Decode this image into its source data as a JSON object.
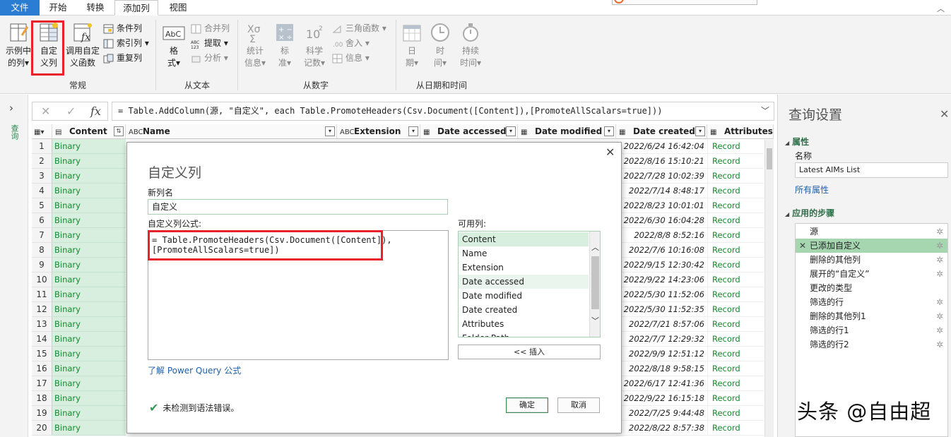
{
  "tabs": {
    "file": "文件",
    "home": "开始",
    "transform": "转换",
    "add_column": "添加列",
    "view": "视图"
  },
  "ribbon": {
    "general": {
      "label": "常规",
      "example_col": [
        "示例中",
        "的列"
      ],
      "custom_col": [
        "自定",
        "义列"
      ],
      "invoke_fn": [
        "调用自定",
        "义函数"
      ],
      "conditional": "条件列",
      "index": "索引列",
      "duplicate": "重复列"
    },
    "text": {
      "label": "从文本",
      "format": [
        "格",
        "式"
      ],
      "merge": "合并列",
      "extract": "提取",
      "parse": "分析"
    },
    "number": {
      "label": "从数字",
      "stats": [
        "统计",
        "信息"
      ],
      "standard": [
        "标",
        "准"
      ],
      "scientific": [
        "科学",
        "记数"
      ],
      "trig": "三角函数",
      "rounding": "舍入",
      "info": "信息"
    },
    "datetime": {
      "label": "从日期和时间",
      "date": [
        "日",
        "期"
      ],
      "time": [
        "时",
        "间"
      ],
      "duration": [
        "持续",
        "时间"
      ]
    }
  },
  "left_pane": {
    "label": "查询"
  },
  "formula_bar": {
    "text": "= Table.AddColumn(源, \"自定义\", each Table.PromoteHeaders(Csv.Document([Content]),[PromoteAllScalars=true]))"
  },
  "grid": {
    "columns": [
      "Content",
      "Name",
      "Extension",
      "Date accessed",
      "Date modified",
      "Date created",
      "Attributes"
    ],
    "column_type_glyphs": [
      "▤",
      "ABC",
      "ABC",
      "▦",
      "▦",
      "▦",
      "▦"
    ],
    "rows": [
      {
        "n": "1",
        "content": "Binary",
        "created": "2022/6/24 16:42:04",
        "attr": "Record"
      },
      {
        "n": "2",
        "content": "Binary",
        "created": "2022/8/16 15:10:21",
        "attr": "Record"
      },
      {
        "n": "3",
        "content": "Binary",
        "created": "2022/7/28 10:02:39",
        "attr": "Record"
      },
      {
        "n": "4",
        "content": "Binary",
        "created": "2022/7/14 8:48:17",
        "attr": "Record"
      },
      {
        "n": "5",
        "content": "Binary",
        "created": "2022/8/23 10:01:01",
        "attr": "Record"
      },
      {
        "n": "6",
        "content": "Binary",
        "created": "2022/6/30 16:04:28",
        "attr": "Record"
      },
      {
        "n": "7",
        "content": "Binary",
        "created": "2022/8/8 8:52:16",
        "attr": "Record"
      },
      {
        "n": "8",
        "content": "Binary",
        "created": "2022/7/6 10:16:08",
        "attr": "Record"
      },
      {
        "n": "9",
        "content": "Binary",
        "created": "2022/9/15 12:30:42",
        "attr": "Record"
      },
      {
        "n": "10",
        "content": "Binary",
        "created": "2022/9/22 14:23:06",
        "attr": "Record"
      },
      {
        "n": "11",
        "content": "Binary",
        "created": "2022/5/30 11:52:06",
        "attr": "Record"
      },
      {
        "n": "12",
        "content": "Binary",
        "created": "2022/5/30 11:52:35",
        "attr": "Record"
      },
      {
        "n": "13",
        "content": "Binary",
        "created": "2022/7/21 8:57:06",
        "attr": "Record"
      },
      {
        "n": "14",
        "content": "Binary",
        "created": "2022/7/7 12:29:32",
        "attr": "Record"
      },
      {
        "n": "15",
        "content": "Binary",
        "created": "2022/9/9 12:51:12",
        "attr": "Record"
      },
      {
        "n": "16",
        "content": "Binary",
        "created": "2022/8/18 9:58:15",
        "attr": "Record"
      },
      {
        "n": "17",
        "content": "Binary",
        "created": "2022/6/17 12:41:36",
        "attr": "Record"
      },
      {
        "n": "18",
        "content": "Binary",
        "created": "2022/9/22 16:15:18",
        "attr": "Record"
      },
      {
        "n": "19",
        "content": "Binary",
        "created": "2022/7/25 9:44:48",
        "attr": "Record"
      },
      {
        "n": "20",
        "content": "Binary",
        "created": "2022/8/22 8:57:38",
        "attr": "Record"
      }
    ]
  },
  "dialog": {
    "title": "自定义列",
    "new_col_label": "新列名",
    "new_col_value": "自定义",
    "formula_label": "自定义列公式:",
    "formula": "= Table.PromoteHeaders(Csv.Document([Content]),\n[PromoteAllScalars=true])",
    "available_label": "可用列:",
    "available": [
      "Content",
      "Name",
      "Extension",
      "Date accessed",
      "Date modified",
      "Date created",
      "Attributes",
      "Folder Path"
    ],
    "insert": "<< 插入",
    "learn_link": "了解 Power Query 公式",
    "status": "未检测到语法错误。",
    "ok": "确定",
    "cancel": "取消"
  },
  "query_settings": {
    "title": "查询设置",
    "props_header": "属性",
    "name_label": "名称",
    "name_value": "Latest AIMs List",
    "all_props": "所有属性",
    "steps_header": "应用的步骤",
    "steps": [
      "源",
      "已添加自定义",
      "删除的其他列",
      "展开的“自定义”",
      "更改的类型",
      "筛选的行",
      "删除的其他列1",
      "筛选的行1",
      "筛选的行2"
    ]
  },
  "watermark": "头条 @自由超",
  "colors": {
    "accent_green": "#2f6f48",
    "file_tab_blue": "#2b7cd3",
    "highlight_red": "#e8212a"
  }
}
